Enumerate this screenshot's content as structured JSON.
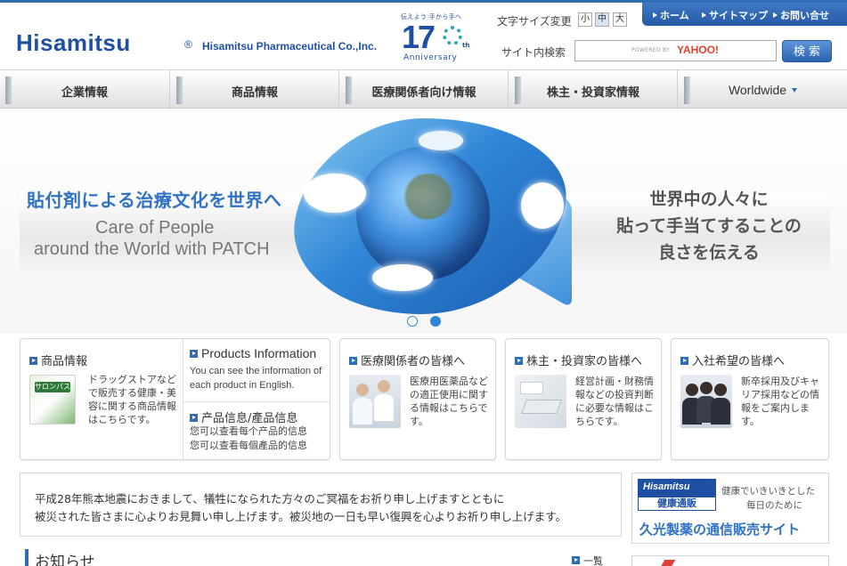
{
  "header": {
    "logo_text": "Hisamitsu",
    "logo_reg": "®",
    "company_name": "Hisamitsu Pharmaceutical Co.,Inc.",
    "anniversary_tagline": "伝えよう 手から手へ",
    "anniversary_number": "17",
    "anniversary_suffix": "th",
    "anniversary_label": "Anniversary",
    "font_size_label": "文字サイズ変更",
    "font_size_small": "小",
    "font_size_medium": "中",
    "font_size_large": "大",
    "top_nav": [
      "ホーム",
      "サイトマップ",
      "お問い合せ"
    ],
    "search_label": "サイト内検索",
    "search_powered": "POWERED BY",
    "search_provider": "YAHOO!",
    "search_button": "検 索"
  },
  "main_nav": [
    "企業情報",
    "商品情報",
    "医療関係者向け情報",
    "株主・投資家情報",
    "Worldwide"
  ],
  "hero": {
    "headline_jp": "貼付剤による治療文化を世界へ",
    "headline_en_1": "Care of People",
    "headline_en_2": "around the World with PATCH",
    "right_line_1": "世界中の人々に",
    "right_line_2": "貼って手当てすることの",
    "right_line_3": "良さを伝える",
    "slide_count": 2,
    "active_slide": 2
  },
  "cards": {
    "products": {
      "title": "商品情報",
      "image_label": "サロンパス",
      "text": "ドラッグストアなどで販売する健康・美容に関する商品情報はこちらです。",
      "en_title": "Products Information",
      "en_text": "You can see the information of each product in English.",
      "cn_title": "产品信息/產品信息",
      "cn_text_1": "您可以查看每个产品的信息",
      "cn_text_2": "您可以查看每個產品的信息"
    },
    "medical": {
      "title": "医療関係者の皆様へ",
      "text": "医療用医薬品などの適正使用に関する情報はこちらです。"
    },
    "investors": {
      "title": "株主・投資家の皆様へ",
      "text": "経営計画・財務情報などの投資判断に必要な情報はこちらです。"
    },
    "recruit": {
      "title": "入社希望の皆様へ",
      "text": "新卒採用及びキャリア採用などの情報をご案内します。"
    }
  },
  "notice": {
    "line_1": "平成28年熊本地震におきまして、犠牲になられた方々のご冥福をお祈り申し上げますとともに",
    "line_2": "被災された皆さまに心よりお見舞い申し上げます。被災地の一日も早い復興を心よりお祈り申し上げます。"
  },
  "ad": {
    "logo_name": "Hisamitsu",
    "logo_sub": "健康通販",
    "copy_1": "健康でいきいきとした",
    "copy_2": "毎日のために",
    "main": "久光製薬の通信販売サイト"
  },
  "news": {
    "title": "お知らせ",
    "more": "一覧"
  },
  "colors": {
    "brand_blue": "#1f4fa3",
    "accent_blue": "#2f6db5",
    "hero_blue": "#2f86d6"
  }
}
